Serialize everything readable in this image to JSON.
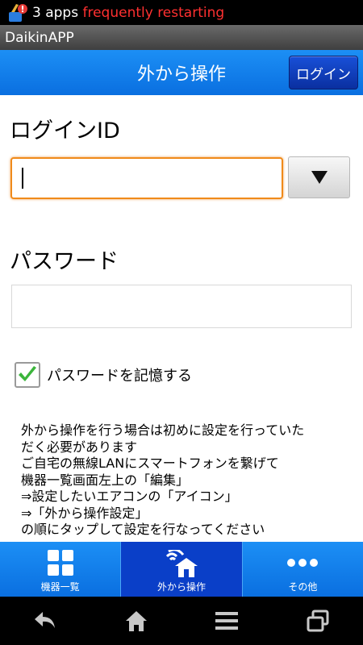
{
  "status_bar": {
    "notification_count": "3 apps",
    "notification_text": " frequently restarting"
  },
  "app_bar": {
    "title": "DaikinAPP"
  },
  "header": {
    "title": "外から操作",
    "login_label": "ログイン"
  },
  "form": {
    "login_id_label": "ログインID",
    "login_id_value": "",
    "password_label": "パスワード",
    "password_value": "",
    "remember_label": "パスワードを記憶する",
    "remember_checked": true
  },
  "instructions": [
    "外から操作を行う場合は初めに設定を行っていた",
    "だく必要があります",
    "ご自宅の無線LANにスマートフォンを繋げて",
    "機器一覧画面左上の「編集」",
    "⇒設定したいエアコンの「アイコン」",
    "⇒「外から操作設定」",
    "の順にタップして設定を行なってください"
  ],
  "bottom_nav": {
    "items": [
      {
        "label": "機器一覧",
        "icon": "grid-icon"
      },
      {
        "label": "外から操作",
        "icon": "remote-house-icon"
      },
      {
        "label": "その他",
        "icon": "more-dots-icon"
      }
    ],
    "active_index": 1
  },
  "system_nav": {
    "icons": [
      "back-icon",
      "home-icon",
      "menu-icon",
      "recent-apps-icon"
    ]
  },
  "colors": {
    "accent_blue": "#0a6fe0",
    "active_tab": "#0a3fc8",
    "focus_orange": "#f08a1a",
    "check_green": "#3bb53b"
  }
}
